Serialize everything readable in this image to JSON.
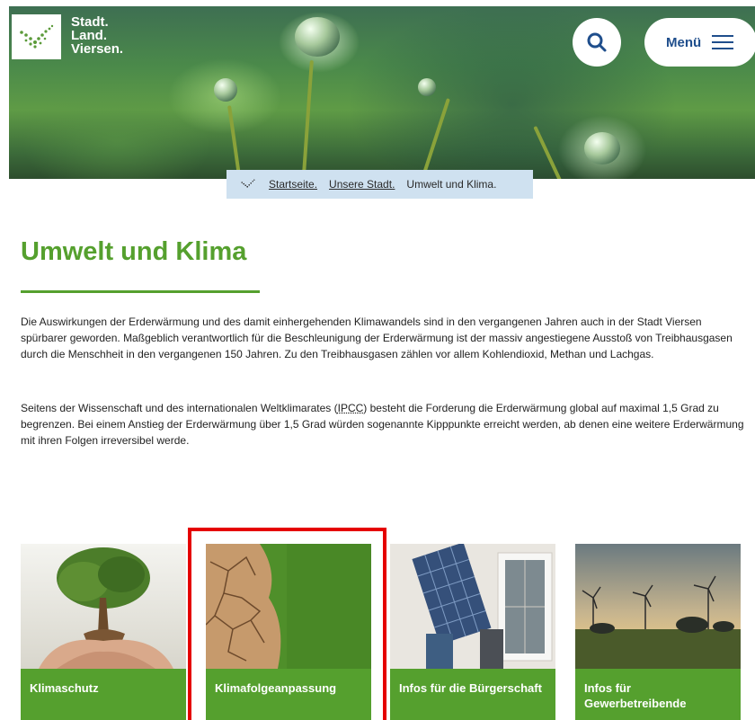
{
  "logo": {
    "line1": "Stadt.",
    "line2": "Land.",
    "line3": "Viersen."
  },
  "header": {
    "search_icon": "search-icon",
    "menu_label": "Menü",
    "menu_icon": "hamburger-icon"
  },
  "breadcrumb": {
    "home_icon": "logo-check-icon",
    "items": [
      "Startseite.",
      "Unsere Stadt.",
      "Umwelt und Klima."
    ]
  },
  "main": {
    "title": "Umwelt und Klima",
    "paragraph1": "Die Auswirkungen der Erderwärmung und des damit einhergehenden Klimawandels sind in den vergangenen Jahren auch in der Stadt Viersen spürbarer geworden. Maßgeblich verantwortlich für die Beschleunigung der Erderwärmung ist der massiv angestiegene Ausstoß von Treibhausgasen durch die Menschheit in den vergangenen 150 Jahren. Zu den Treibhausgasen zählen vor allem Kohlendioxid, Methan und Lachgas.",
    "paragraph2_before": "Seitens der Wissenschaft und des internationalen Weltklimarates (",
    "paragraph2_abbr": "IPCC",
    "paragraph2_after": ") besteht die Forderung die Erderwärmung global auf maximal 1,5 Grad zu begrenzen. Bei einem Anstieg der Erderwärmung über 1,5 Grad würden sogenannte Kipppunkte erreicht werden, ab denen eine weitere Erderwärmung mit ihren Folgen irreversibel werde."
  },
  "cards": [
    {
      "label": "Klimaschutz",
      "image": "tree-in-hands"
    },
    {
      "label": "Klimafolgeanpassung",
      "image": "cracked-earth-and-grass"
    },
    {
      "label": "Infos für die Bürgerschaft",
      "image": "solar-panel-installation"
    },
    {
      "label": "Infos für Gewerbetreibende",
      "image": "wind-turbines-sunset"
    }
  ],
  "colors": {
    "brand_green": "#55a02e",
    "brand_blue": "#1f4e8c",
    "breadcrumb_bg": "#cfe1f0",
    "highlight": "#e50000"
  }
}
